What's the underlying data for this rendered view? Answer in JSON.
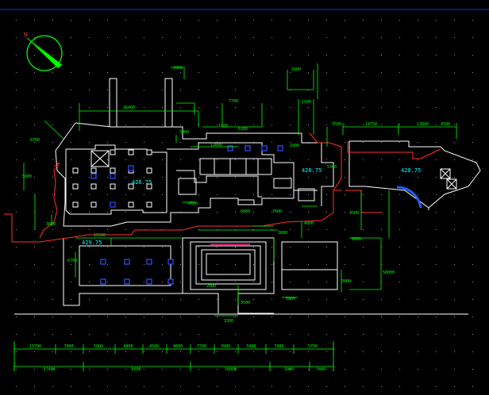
{
  "colors": {
    "background": "#000000",
    "dimension": "#00ff00",
    "outline": "#ffffff",
    "site_boundary": "#ff3030",
    "elevation_text": "#00ffff",
    "column_blue": "#2040ff"
  },
  "north_arrow": {
    "icon": "north-arrow-icon",
    "letter": "N"
  },
  "elevations": [
    "428.75",
    "428.75",
    "428.75",
    "429.75"
  ],
  "top_dims": [
    "2900",
    "16400",
    "7700",
    "3900",
    "1500",
    "14750",
    "13800",
    "3500",
    "4500"
  ],
  "bottom_row1": [
    "15700",
    "7900",
    "5000",
    "4800",
    "4500",
    "4800",
    "7700",
    "3900",
    "5000",
    "7900",
    "5700"
  ],
  "bottom_row2": [
    "37400",
    "6000",
    "58000",
    "3900",
    "7400"
  ],
  "left_dims": [
    "8700",
    "5800",
    "3800",
    "6700",
    "15500"
  ],
  "right_dims": [
    "5300",
    "4500",
    "6000",
    "3000",
    "58000"
  ],
  "misc_dims": [
    "3900",
    "6300",
    "13800",
    "1200",
    "2900",
    "4500",
    "6800",
    "7600",
    "4800",
    "3800",
    "2000",
    "3500",
    "3300",
    "5800"
  ]
}
